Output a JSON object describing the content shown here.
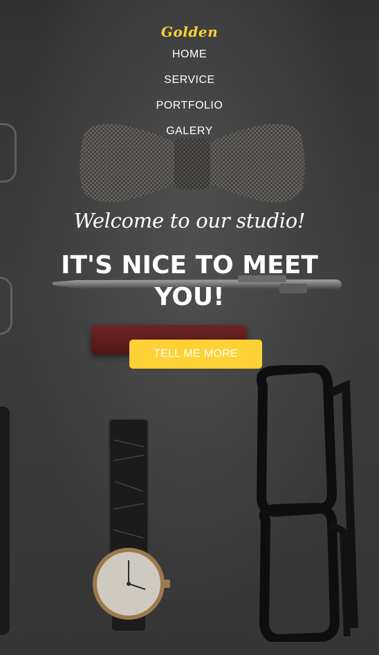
{
  "brand": {
    "name": "Golden"
  },
  "nav": {
    "items": [
      {
        "label": "HOME"
      },
      {
        "label": "SERVICE"
      },
      {
        "label": "PORTFOLIO"
      },
      {
        "label": "GALERY"
      }
    ]
  },
  "hero": {
    "subheading": "Welcome to our studio!",
    "heading": "IT'S NICE TO MEET YOU!",
    "cta_label": "TELL ME MORE",
    "background_objects": [
      "bow-tie",
      "pen",
      "eraser",
      "wristwatch",
      "eyeglasses"
    ]
  },
  "colors": {
    "accent": "#fed136",
    "background": "#3f3f3f",
    "text": "#ffffff"
  }
}
